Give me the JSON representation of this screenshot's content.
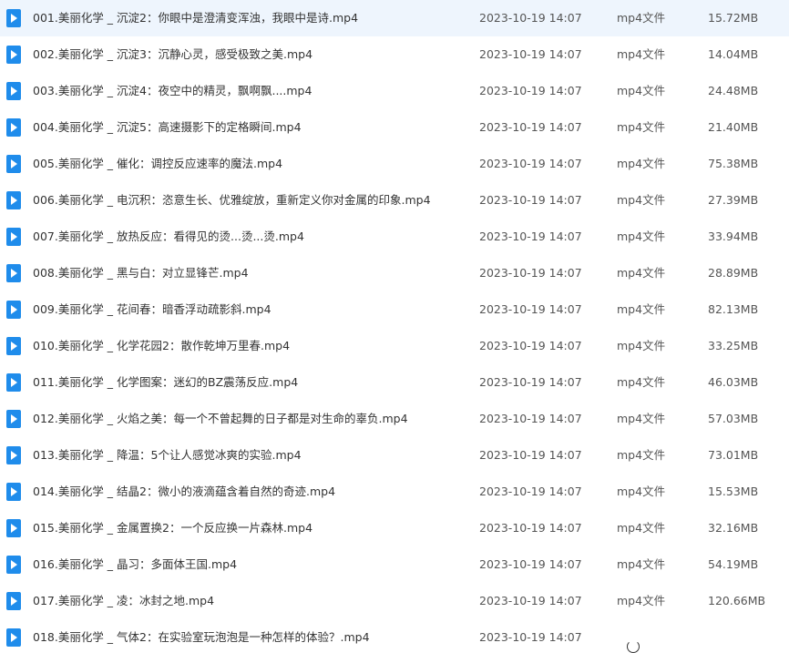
{
  "files": [
    {
      "name": "001.美丽化学 _ 沉淀2：你眼中是澄清变浑浊，我眼中是诗.mp4",
      "date": "2023-10-19 14:07",
      "type": "mp4文件",
      "size": "15.72MB",
      "icon": "video-file-icon"
    },
    {
      "name": "002.美丽化学 _ 沉淀3：沉静心灵，感受极致之美.mp4",
      "date": "2023-10-19 14:07",
      "type": "mp4文件",
      "size": "14.04MB",
      "icon": "video-file-icon"
    },
    {
      "name": "003.美丽化学 _ 沉淀4：夜空中的精灵，飘啊飘....mp4",
      "date": "2023-10-19 14:07",
      "type": "mp4文件",
      "size": "24.48MB",
      "icon": "video-file-icon"
    },
    {
      "name": "004.美丽化学 _ 沉淀5：高速摄影下的定格瞬间.mp4",
      "date": "2023-10-19 14:07",
      "type": "mp4文件",
      "size": "21.40MB",
      "icon": "video-file-icon"
    },
    {
      "name": "005.美丽化学 _ 催化：调控反应速率的魔法.mp4",
      "date": "2023-10-19 14:07",
      "type": "mp4文件",
      "size": "75.38MB",
      "icon": "video-file-icon"
    },
    {
      "name": "006.美丽化学 _ 电沉积：恣意生长、优雅绽放，重新定义你对金属的印象.mp4",
      "date": "2023-10-19 14:07",
      "type": "mp4文件",
      "size": "27.39MB",
      "icon": "video-file-icon"
    },
    {
      "name": "007.美丽化学 _ 放热反应：看得见的烫...烫...烫.mp4",
      "date": "2023-10-19 14:07",
      "type": "mp4文件",
      "size": "33.94MB",
      "icon": "video-file-icon"
    },
    {
      "name": "008.美丽化学 _ 黑与白：对立显锋芒.mp4",
      "date": "2023-10-19 14:07",
      "type": "mp4文件",
      "size": "28.89MB",
      "icon": "video-file-icon"
    },
    {
      "name": "009.美丽化学 _ 花间春：暗香浮动疏影斜.mp4",
      "date": "2023-10-19 14:07",
      "type": "mp4文件",
      "size": "82.13MB",
      "icon": "video-file-icon"
    },
    {
      "name": "010.美丽化学 _ 化学花园2：散作乾坤万里春.mp4",
      "date": "2023-10-19 14:07",
      "type": "mp4文件",
      "size": "33.25MB",
      "icon": "video-file-icon"
    },
    {
      "name": "011.美丽化学 _ 化学图案：迷幻的BZ震荡反应.mp4",
      "date": "2023-10-19 14:07",
      "type": "mp4文件",
      "size": "46.03MB",
      "icon": "video-file-icon"
    },
    {
      "name": "012.美丽化学 _ 火焰之美：每一个不曾起舞的日子都是对生命的辜负.mp4",
      "date": "2023-10-19 14:07",
      "type": "mp4文件",
      "size": "57.03MB",
      "icon": "video-file-icon"
    },
    {
      "name": "013.美丽化学 _ 降温：5个让人感觉冰爽的实验.mp4",
      "date": "2023-10-19 14:07",
      "type": "mp4文件",
      "size": "73.01MB",
      "icon": "video-file-icon"
    },
    {
      "name": "014.美丽化学 _ 结晶2：微小的液滴蕴含着自然的奇迹.mp4",
      "date": "2023-10-19 14:07",
      "type": "mp4文件",
      "size": "15.53MB",
      "icon": "video-file-icon"
    },
    {
      "name": "015.美丽化学 _ 金属置换2：一个反应换一片森林.mp4",
      "date": "2023-10-19 14:07",
      "type": "mp4文件",
      "size": "32.16MB",
      "icon": "video-file-icon"
    },
    {
      "name": "016.美丽化学 _ 晶习：多面体王国.mp4",
      "date": "2023-10-19 14:07",
      "type": "mp4文件",
      "size": "54.19MB",
      "icon": "video-file-icon"
    },
    {
      "name": "017.美丽化学 _ 凌：冰封之地.mp4",
      "date": "2023-10-19 14:07",
      "type": "mp4文件",
      "size": "120.66MB",
      "icon": "video-file-icon"
    },
    {
      "name": "018.美丽化学 _ 气体2：在实验室玩泡泡是一种怎样的体验？.mp4",
      "date": "2023-10-19 14:07",
      "type": "",
      "size": "",
      "icon": "video-file-icon"
    }
  ]
}
